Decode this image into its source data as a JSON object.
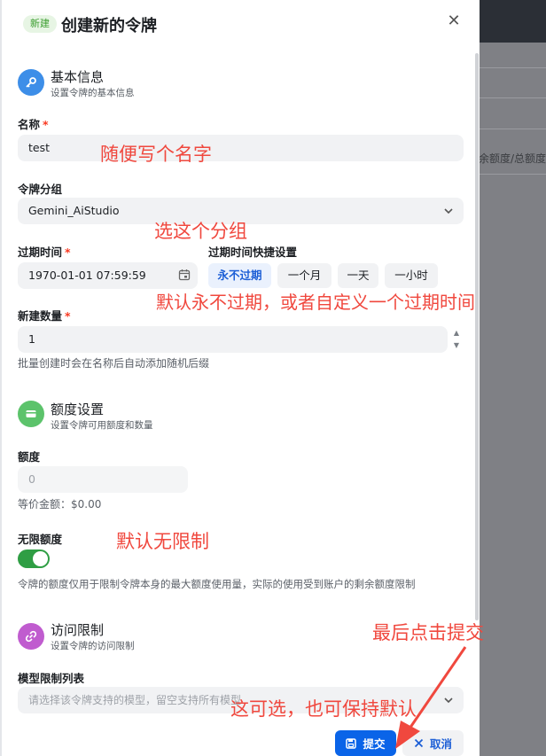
{
  "header": {
    "badge": "新建",
    "title": "创建新的令牌",
    "close_glyph": "✕"
  },
  "background": {
    "column_header": "余额度/总额度"
  },
  "basic": {
    "title": "基本信息",
    "subtitle": "设置令牌的基本信息",
    "name_label": "名称",
    "name_value": "test",
    "group_label": "令牌分组",
    "group_value": "Gemini_AiStudio",
    "expire_label": "过期时间",
    "expire_value": "1970-01-01 07:59:59",
    "quick_label": "过期时间快捷设置",
    "quick_options": [
      "永不过期",
      "一个月",
      "一天",
      "一小时"
    ],
    "count_label": "新建数量",
    "count_value": "1",
    "count_hint": "批量创建时会在名称后自动添加随机后缀",
    "required_mark": "*"
  },
  "quota": {
    "title": "额度设置",
    "subtitle": "设置令牌可用额度和数量",
    "amount_label": "额度",
    "amount_placeholder": "0",
    "equivalent": "等价金额：$0.00",
    "unlimited_label": "无限额度",
    "unlimited_on": true,
    "note": "令牌的额度仅用于限制令牌本身的最大额度使用量，实际的使用受到账户的剩余额度限制"
  },
  "access": {
    "title": "访问限制",
    "subtitle": "设置令牌的访问限制",
    "models_label": "模型限制列表",
    "models_placeholder": "请选择该令牌支持的模型，留空支持所有模型"
  },
  "footer": {
    "submit": "提交",
    "cancel": "取消"
  },
  "annotations": {
    "name": "随便写个名字",
    "group": "选这个分组",
    "expire": "默认永不过期，或者自定义一个过期时间",
    "unlimited": "默认无限制",
    "submit": "最后点击提交",
    "models": "这可选，也可保持默认"
  },
  "colors": {
    "primary": "#0a64e8",
    "toggle_on": "#2f9e44",
    "annotation": "#f0483e",
    "required": "#f93920"
  }
}
